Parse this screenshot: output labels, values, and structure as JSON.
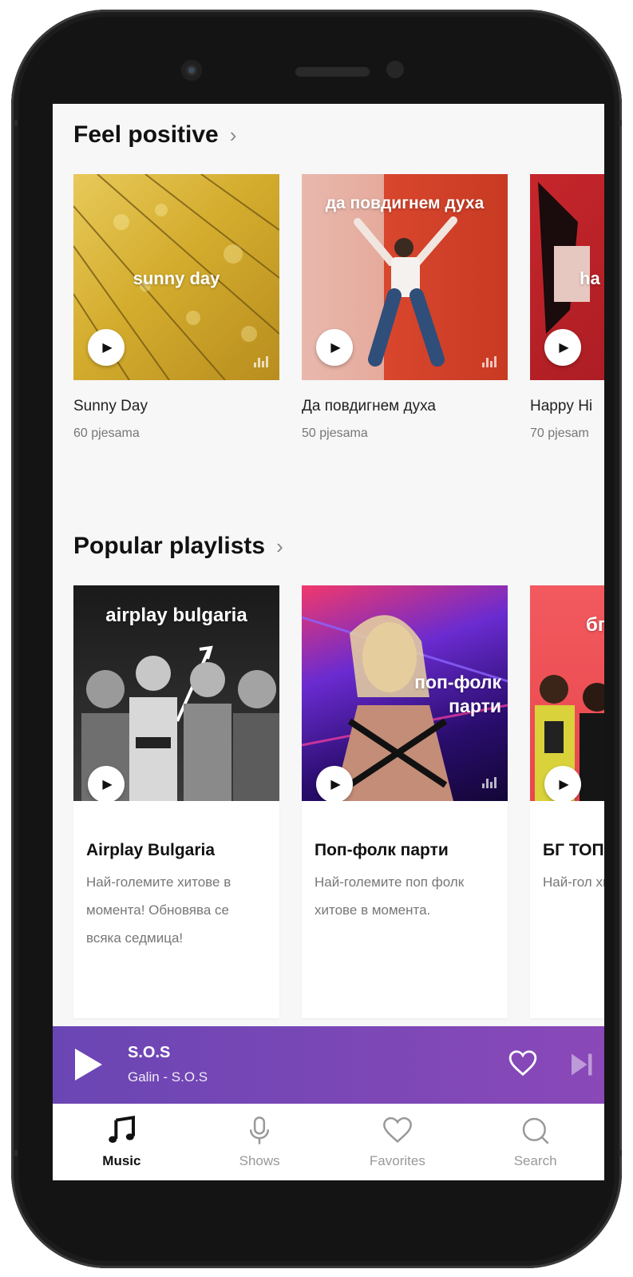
{
  "sections": {
    "feel_positive": {
      "title": "Feel positive",
      "cards": [
        {
          "cover_text": "sunny day",
          "title": "Sunny Day",
          "subtitle": "60 pjesama"
        },
        {
          "cover_text": "да повдигнем духа",
          "title": "Да повдигнем духа",
          "subtitle": "50 pjesama"
        },
        {
          "cover_text": "ha",
          "title": "Happy Hi",
          "subtitle": "70 pjesam"
        }
      ]
    },
    "popular_playlists": {
      "title": "Popular playlists",
      "cards": [
        {
          "cover_text": "airplay bulgaria",
          "title": "Airplay Bulgaria",
          "description": "Най-големите хитове в момента! Обновява се всяка седмица!"
        },
        {
          "cover_text": "поп-фолк парти",
          "title": "Поп-фолк парти",
          "description": "Най-големите поп фолк хитове в момента."
        },
        {
          "cover_text": "бг",
          "title": "БГ ТОП",
          "description": "Най-гол хитове"
        }
      ]
    }
  },
  "player": {
    "title": "S.O.S",
    "subtitle": "Galin - S.O.S"
  },
  "tabs": [
    {
      "label": "Music",
      "icon": "music-note-icon",
      "active": true
    },
    {
      "label": "Shows",
      "icon": "microphone-icon",
      "active": false
    },
    {
      "label": "Favorites",
      "icon": "heart-icon",
      "active": false
    },
    {
      "label": "Search",
      "icon": "search-icon",
      "active": false
    }
  ],
  "colors": {
    "accent": "#7a47b6",
    "background": "#f7f7f8"
  }
}
